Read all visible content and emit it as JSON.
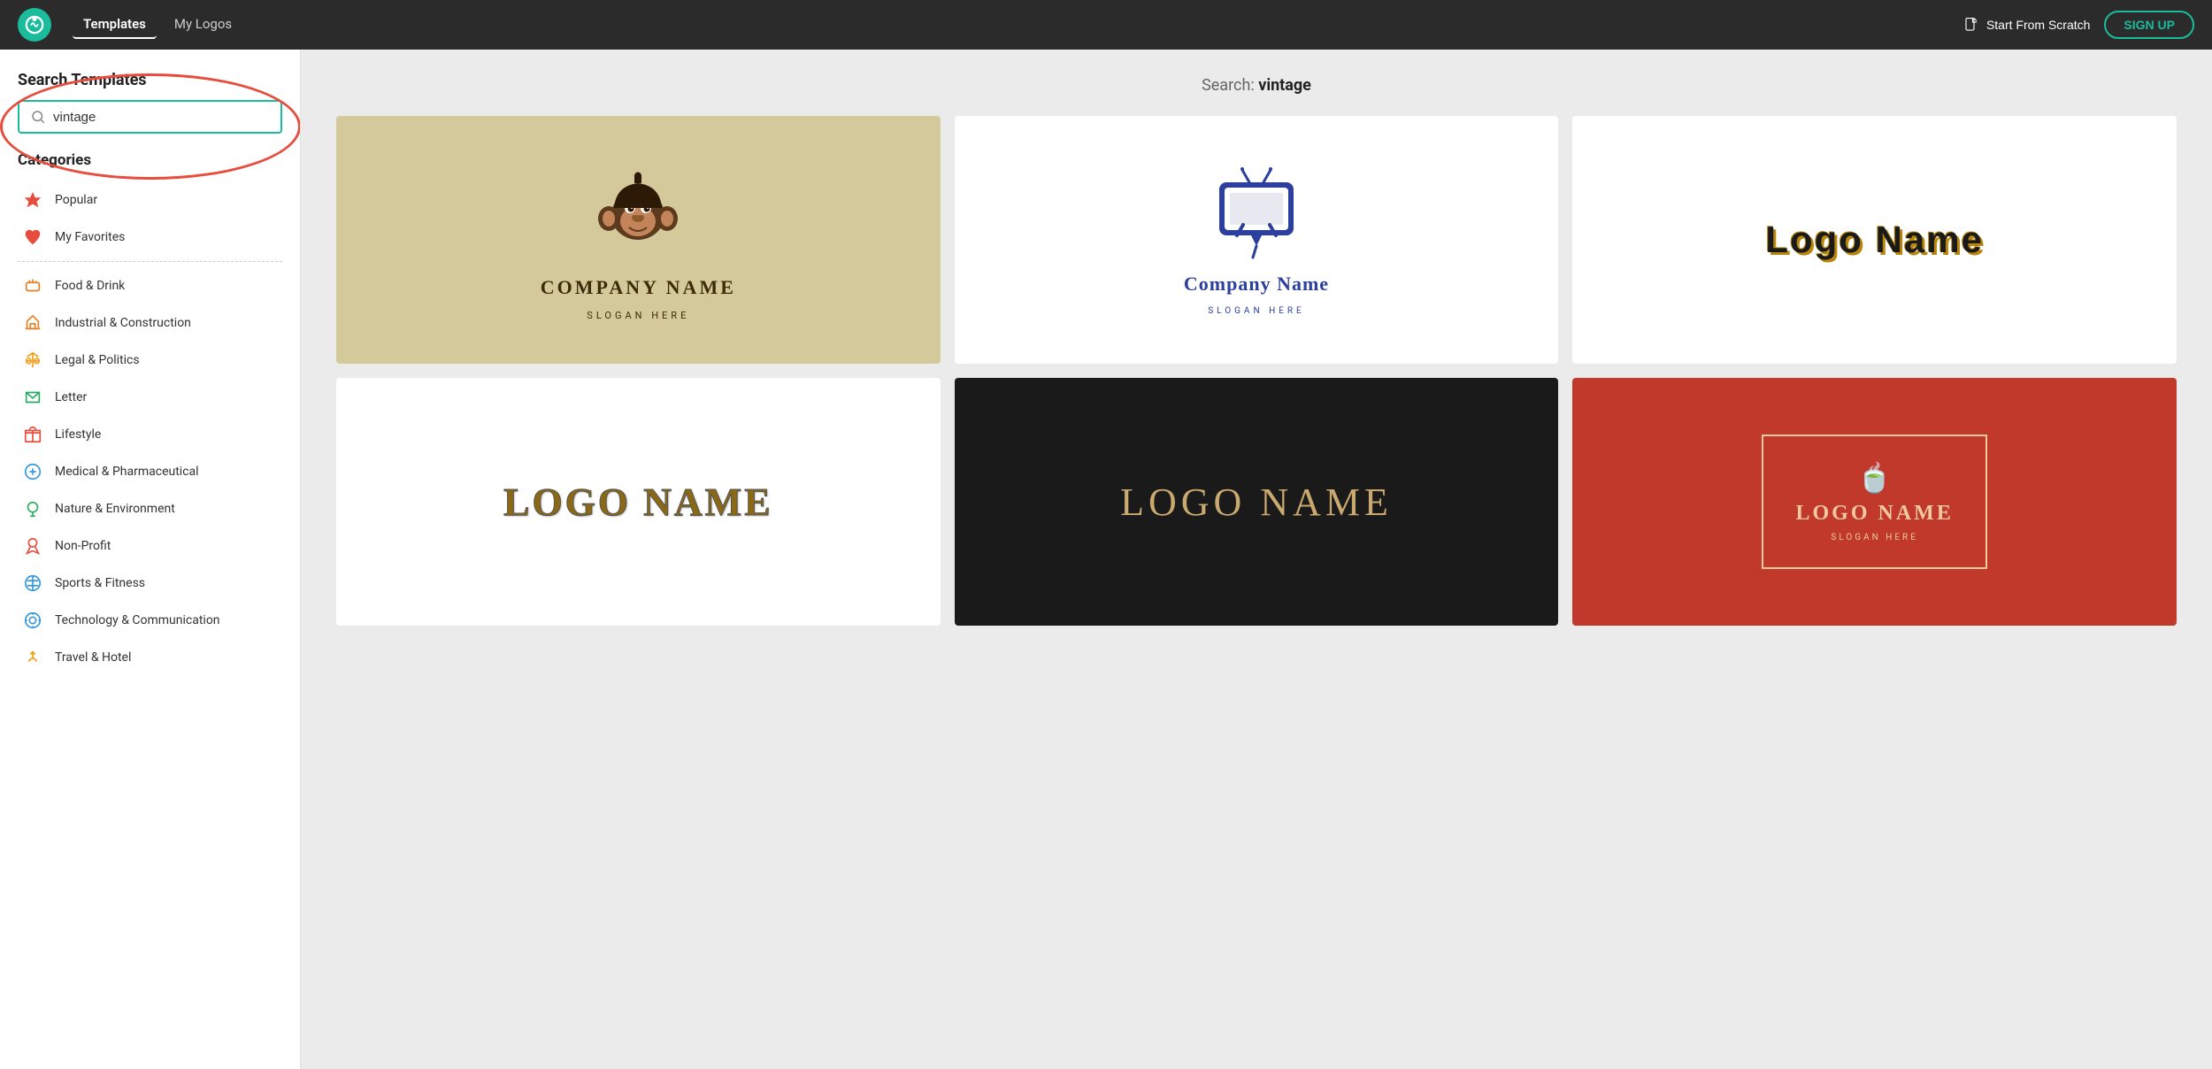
{
  "topnav": {
    "logo_alt": "logo",
    "links": [
      {
        "label": "Templates",
        "active": true
      },
      {
        "label": "My Logos",
        "active": false
      }
    ],
    "scratch_label": "Start From Scratch",
    "signup_label": "SIGN UP"
  },
  "sidebar": {
    "search_label": "Search Templates",
    "search_value": "vintage",
    "search_placeholder": "vintage",
    "categories_title": "Categories",
    "categories": [
      {
        "label": "Popular",
        "icon": "star",
        "color": "#e74c3c"
      },
      {
        "label": "My Favorites",
        "icon": "heart",
        "color": "#e74c3c"
      },
      {
        "label": "Food & Drink",
        "icon": "food",
        "color": "#e67e22",
        "divider": true
      },
      {
        "label": "Industrial & Construction",
        "icon": "construction",
        "color": "#e67e22"
      },
      {
        "label": "Legal & Politics",
        "icon": "scales",
        "color": "#f39c12"
      },
      {
        "label": "Letter",
        "icon": "letter",
        "color": "#27ae60"
      },
      {
        "label": "Lifestyle",
        "icon": "gift",
        "color": "#e74c3c"
      },
      {
        "label": "Medical & Pharmaceutical",
        "icon": "medical",
        "color": "#3498db"
      },
      {
        "label": "Nature & Environment",
        "icon": "nature",
        "color": "#27ae60"
      },
      {
        "label": "Non-Profit",
        "icon": "ribbon",
        "color": "#e74c3c"
      },
      {
        "label": "Sports & Fitness",
        "icon": "sports",
        "color": "#3498db"
      },
      {
        "label": "Technology & Communication",
        "icon": "tech",
        "color": "#3498db"
      },
      {
        "label": "Travel & Hotel",
        "icon": "travel",
        "color": "#f39c12"
      }
    ]
  },
  "main": {
    "search_prefix": "Search:",
    "search_term": "vintage",
    "cards": [
      {
        "id": "monkey",
        "type": "monkey",
        "company": "COMPANY NAME",
        "slogan": "SLOGAN HERE"
      },
      {
        "id": "tv",
        "type": "tv",
        "company": "Company Name",
        "slogan": "SLOGAN HERE"
      },
      {
        "id": "logoblack",
        "type": "logoblack",
        "text": "Logo Name"
      },
      {
        "id": "logowestern",
        "type": "logowestern",
        "text": "LOGO NAME"
      },
      {
        "id": "logodark",
        "type": "logodark",
        "text": "LOGO NAME"
      },
      {
        "id": "logored",
        "type": "logored",
        "text": "LOGO NAME",
        "slogan": "SLOGAN HERE"
      }
    ]
  }
}
